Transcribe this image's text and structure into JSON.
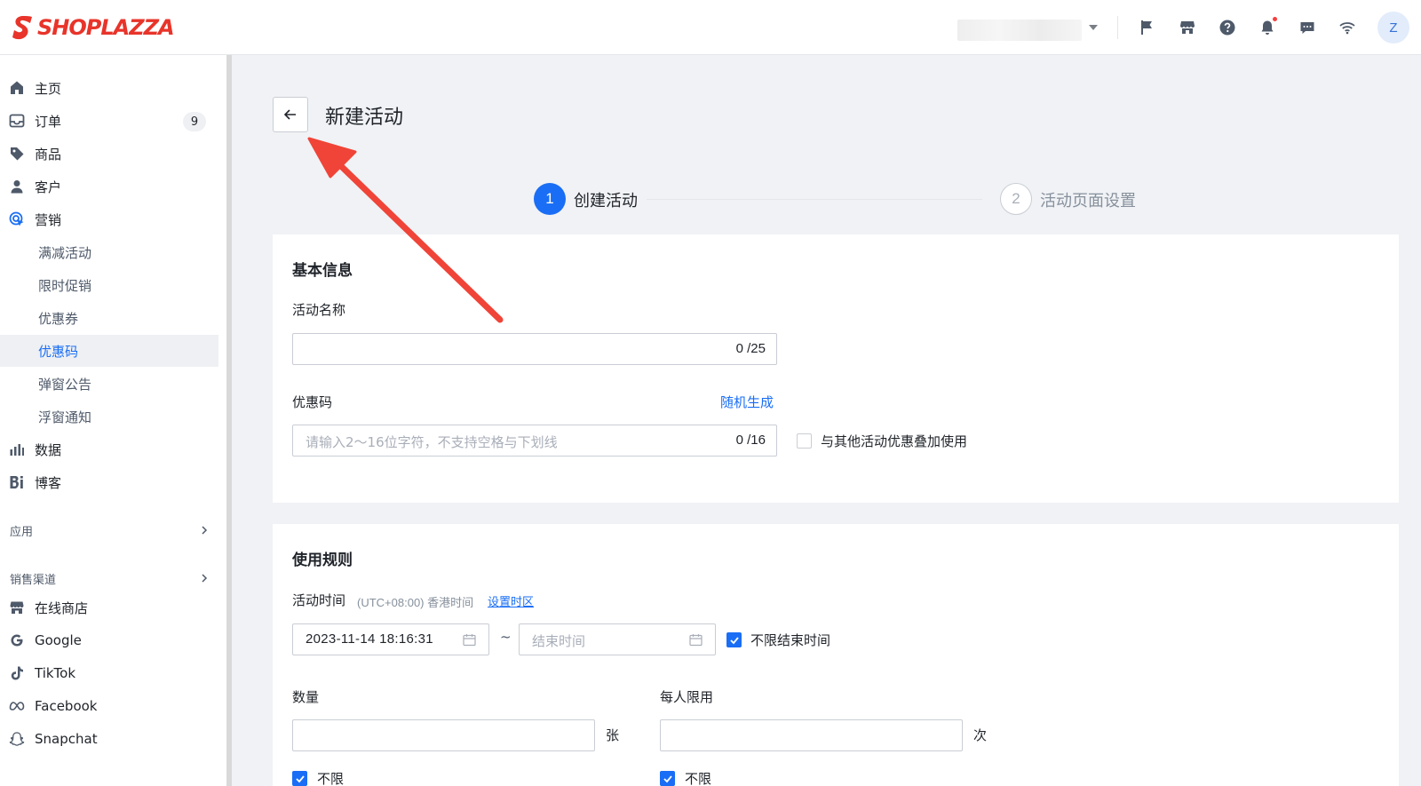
{
  "topbar": {
    "logo_text": "SHOPLAZZA",
    "icons": [
      "flag-icon",
      "store-icon",
      "help-icon",
      "bell-icon",
      "message-icon",
      "wifi-icon"
    ],
    "avatar_initial": "Z"
  },
  "sidebar": {
    "items": [
      {
        "label": "主页",
        "icon": "home-icon"
      },
      {
        "label": "订单",
        "icon": "inbox-icon",
        "badge": "9"
      },
      {
        "label": "商品",
        "icon": "tag-icon"
      },
      {
        "label": "客户",
        "icon": "user-icon"
      },
      {
        "label": "营销",
        "icon": "marketing-icon"
      }
    ],
    "marketing_sub": [
      "满减活动",
      "限时促销",
      "优惠券",
      "优惠码",
      "弹窗公告",
      "浮窗通知"
    ],
    "selected_sub": "优惠码",
    "items_after": [
      {
        "label": "数据",
        "icon": "bar-chart-icon"
      },
      {
        "label": "博客",
        "icon": "blog-icon"
      }
    ],
    "apps_label": "应用",
    "channels_label": "销售渠道",
    "channels": [
      {
        "label": "在线商店",
        "icon": "store-icon"
      },
      {
        "label": "Google",
        "icon": "google-icon"
      },
      {
        "label": "TikTok",
        "icon": "tiktok-icon"
      },
      {
        "label": "Facebook",
        "icon": "meta-icon"
      },
      {
        "label": "Snapchat",
        "icon": "snapchat-icon"
      }
    ]
  },
  "page": {
    "title": "新建活动",
    "steps": [
      {
        "num": "1",
        "label": "创建活动",
        "active": true
      },
      {
        "num": "2",
        "label": "活动页面设置",
        "active": false
      }
    ]
  },
  "basic_info": {
    "title": "基本信息",
    "name_label": "活动名称",
    "name_value": "",
    "name_counter": "0 /25",
    "code_label": "优惠码",
    "random_link": "随机生成",
    "code_placeholder": "请输入2～16位字符，不支持空格与下划线",
    "code_counter": "0 /16",
    "stack_checkbox_label": "与其他活动优惠叠加使用",
    "stack_checked": false
  },
  "usage_rules": {
    "title": "使用规则",
    "time_label": "活动时间",
    "timezone_hint": "(UTC+08:00) 香港时间",
    "timezone_link": "设置时区",
    "start_time": "2023-11-14 18:16:31",
    "range_sep": "~",
    "end_placeholder": "结束时间",
    "no_end_label": "不限结束时间",
    "no_end_checked": true,
    "quantity_label": "数量",
    "quantity_unit": "张",
    "quantity_unlimited_label": "不限",
    "per_user_label": "每人限用",
    "per_user_unit": "次",
    "per_user_unlimited_label": "不限"
  },
  "colors": {
    "accent": "#1a6ef5",
    "brand": "#e8342a",
    "annotation_arrow": "#f04438"
  }
}
